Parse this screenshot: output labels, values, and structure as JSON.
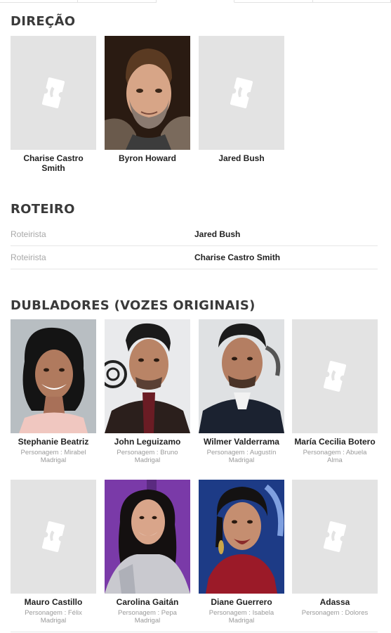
{
  "sections": {
    "direction": "DIREÇÃO",
    "writing": "ROTEIRO",
    "voices": "DUBLADORES (VOZES ORIGINAIS)"
  },
  "directors": [
    {
      "name": "Charise Castro Smith",
      "photo": "placeholder-ticket-icon"
    },
    {
      "name": "Byron Howard",
      "photo": "portrait"
    },
    {
      "name": "Jared Bush",
      "photo": "placeholder-ticket-icon"
    }
  ],
  "writers": [
    {
      "job": "Roteirista",
      "name": "Jared Bush"
    },
    {
      "job": "Roteirista",
      "name": "Charise Castro Smith"
    }
  ],
  "cast": [
    {
      "name": "Stephanie Beatriz",
      "role": "Personagem : Mirabel Madrigal",
      "photo": "portrait"
    },
    {
      "name": "John Leguizamo",
      "role": "Personagem : Bruno Madrigal",
      "photo": "portrait"
    },
    {
      "name": "Wilmer Valderrama",
      "role": "Personagem : Augustín Madrigal",
      "photo": "portrait"
    },
    {
      "name": "María Cecilia Botero",
      "role": "Personagem : Abuela Alma",
      "photo": "placeholder-ticket-icon"
    },
    {
      "name": "Mauro Castillo",
      "role": "Personagem : Félix Madrigal",
      "photo": "placeholder-ticket-icon"
    },
    {
      "name": "Carolina Gaitán",
      "role": "Personagem : Pepa Madrigal",
      "photo": "portrait"
    },
    {
      "name": "Diane Guerrero",
      "role": "Personagem : Isabela Madrigal",
      "photo": "portrait"
    },
    {
      "name": "Adassa",
      "role": "Personagem : Dolores",
      "photo": "placeholder-ticket-icon"
    }
  ],
  "colors": {
    "placeholder_bg": "#e3e3e3",
    "heading": "#3a3a3a",
    "muted": "#a8a8a8",
    "divider": "#e6e6e6"
  }
}
